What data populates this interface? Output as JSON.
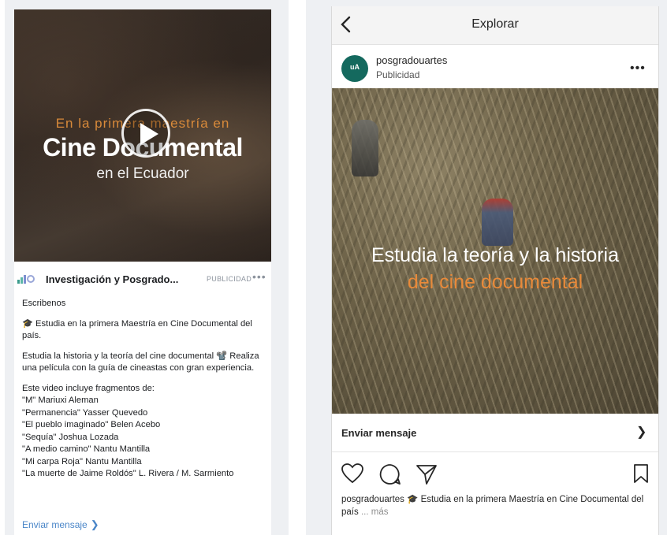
{
  "facebook": {
    "video": {
      "overlay_line1": "En la primera maestría en",
      "overlay_line2": "Cine Documental",
      "overlay_line3": "en el Ecuador"
    },
    "page_name": "Investigación y Posgrado...",
    "sponsored": "PUBLICIDAD",
    "more": "•••",
    "body": {
      "p1": "Escribenos",
      "p2": "🎓 Estudia en la primera Maestría en Cine Documental del país.",
      "p3": "Estudia la historia y la teoría del cine documental 📽️ Realiza una película con la guía de cineastas con gran experiencia.",
      "p4_intro": "Este video incluye fragmentos de:",
      "credits": [
        "\"M\" Mariuxi Aleman",
        "\"Permanencia\" Yasser Quevedo",
        "\"El pueblo imaginado\" Belen Acebo",
        "\"Sequía\" Joshua Lozada",
        "\"A medio camino\" Nantu Mantilla",
        "\"Mi carpa Roja\" Nantu Mantilla",
        "\"La muerte de Jaime Roldós\" L. Rivera / M. Sarmiento"
      ]
    },
    "cta": "Enviar mensaje"
  },
  "instagram": {
    "nav_title": "Explorar",
    "username": "posgradouartes",
    "sponsored": "Publicidad",
    "avatar_text": "uA",
    "more": "•••",
    "media": {
      "overlay_line1": "Estudia la teoría y la historia",
      "overlay_line2": "del cine documental"
    },
    "cta": "Enviar mensaje",
    "caption_user": "posgradouartes",
    "caption_text": "🎓 Estudia en la primera Maestría en Cine Documental del país",
    "caption_more": "... más"
  },
  "colors": {
    "fb_link": "#4a86c8",
    "overlay_orange": "#d98a3a",
    "ig_avatar": "#14695e"
  }
}
